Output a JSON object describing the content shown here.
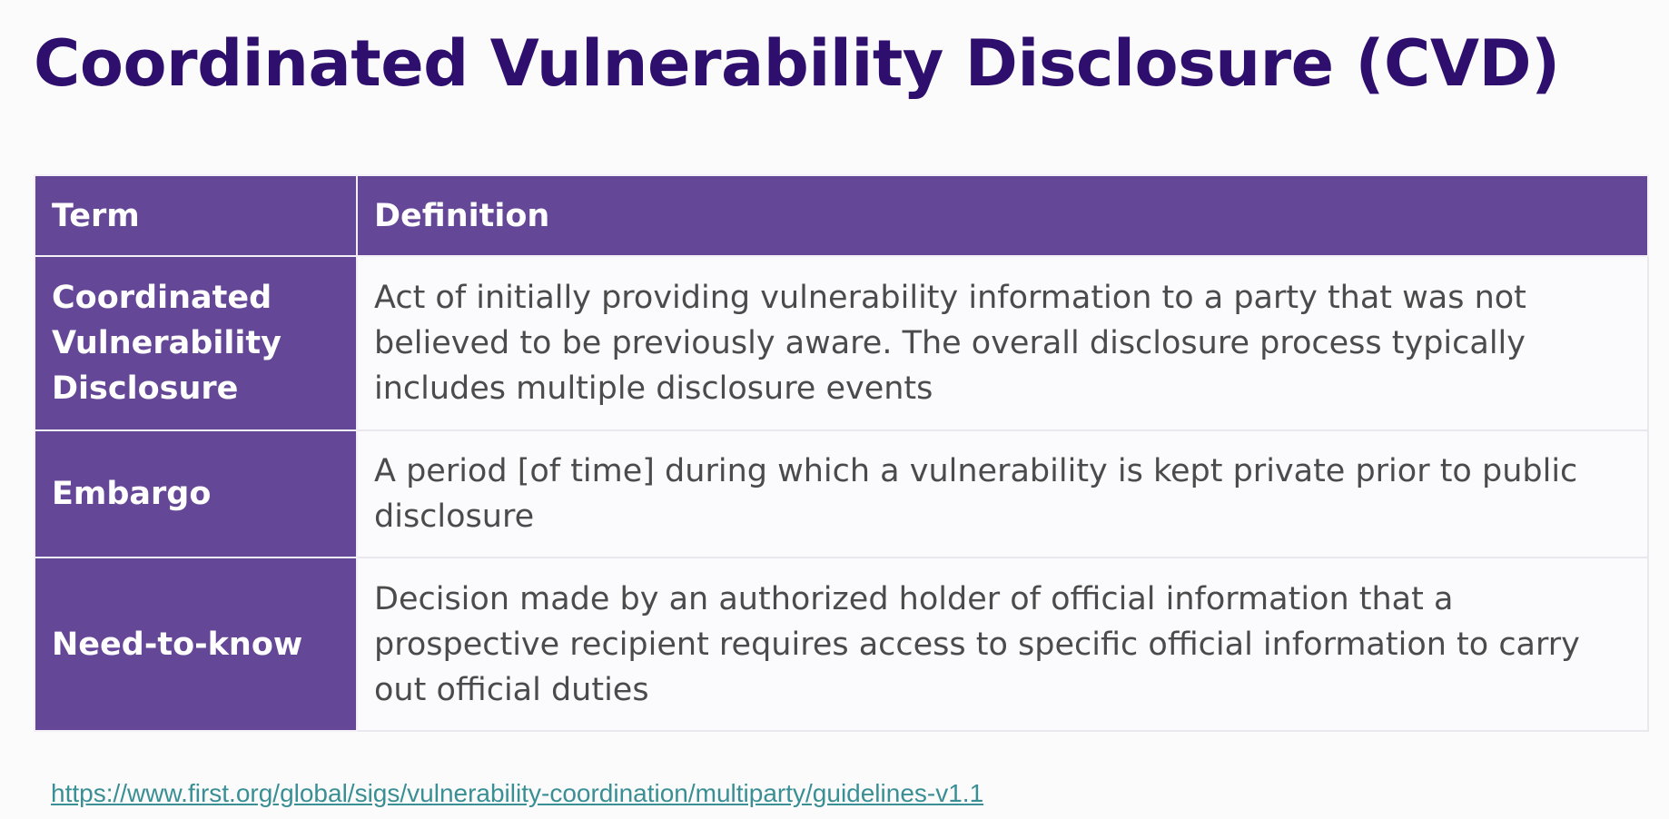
{
  "slide": {
    "title": "Coordinated Vulnerability Disclosure (CVD)"
  },
  "table": {
    "headers": {
      "term": "Term",
      "definition": "Definition"
    },
    "rows": [
      {
        "term": "Coordinated Vulnerability Disclosure",
        "definition": "Act of initially providing vulnerability information to a party that was not believed to be previously aware. The overall disclosure process typically includes multiple disclosure events"
      },
      {
        "term": "Embargo",
        "definition": "A period [of time] during which a vulnerability is kept private prior to public disclosure"
      },
      {
        "term": "Need-to-know",
        "definition": "Decision made by an authorized holder of official information that a prospective recipient requires access to specific official information to carry out official duties"
      }
    ]
  },
  "footer": {
    "link_text": "https://www.first.org/global/sigs/vulnerability-coordination/multiparty/guidelines-v1.1"
  },
  "colors": {
    "title": "#2e0f6e",
    "header_bg": "#654797",
    "definition_text": "#4b4b4b",
    "link": "#3a8f94"
  }
}
